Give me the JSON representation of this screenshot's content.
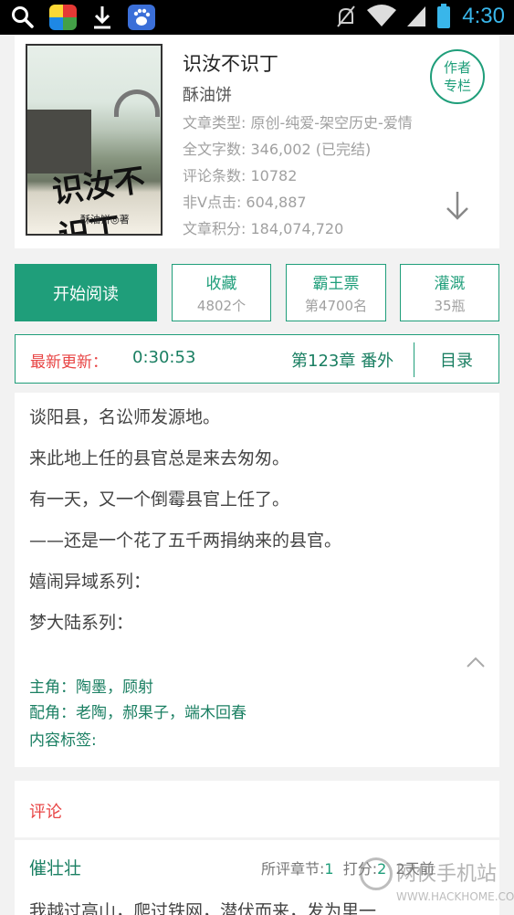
{
  "status_bar": {
    "time": "4:30",
    "icons": [
      "search-icon",
      "game-center-icon",
      "download-icon",
      "baidu-icon",
      "mute-icon",
      "wifi-icon",
      "signal-icon",
      "battery-icon"
    ]
  },
  "book": {
    "title": "识汝不识丁",
    "author": "酥油饼",
    "cover_title": "识汝不识丁",
    "cover_author": "酥油饼◎著",
    "meta": [
      "文章类型: 原创-纯爱-架空历史-爱情",
      "全文字数: 346,002 (已完结)",
      "评论条数: 10782",
      "非V点击: 604,887",
      "文章积分: 184,074,720"
    ],
    "author_column_label_1": "作者",
    "author_column_label_2": "专栏"
  },
  "actions": {
    "read": "开始阅读",
    "favorite": {
      "label": "收藏",
      "value": "4802个"
    },
    "overlord": {
      "label": "霸王票",
      "value": "第4700名"
    },
    "nutrient": {
      "label": "灌溉",
      "value": "35瓶"
    }
  },
  "latest_update": {
    "label": "最新更新：",
    "time": "0:30:53",
    "chapter": "第123章  番外",
    "toc": "目录"
  },
  "synopsis": {
    "lines": [
      "谈阳县，名讼师发源地。",
      "来此地上任的县官总是来去匆匆。",
      "有一天，又一个倒霉县官上任了。",
      "——还是一个花了五千两捐纳来的县官。",
      "嬉闹异域系列：",
      "梦大陆系列："
    ],
    "protagonists": "主角：陶墨，顾射",
    "supporting": "配角：老陶，郝果子，端木回春",
    "tags": "内容标签:"
  },
  "comments": {
    "header": "评论",
    "first": {
      "user": "催壮壮",
      "chapter_label": "所评章节:",
      "chapter_value": "1",
      "score_label": "打分:",
      "score_value": "2",
      "time": "2天前",
      "body": "我越过高山，爬过铁网，潜伏而来，发为里一"
    }
  },
  "watermark": {
    "text": "网侠手机站",
    "sub": "WWW.HACKHOME.COM"
  },
  "colors": {
    "accent": "#1f9e7a",
    "accent_text": "#1a7f62",
    "highlight": "#e84545",
    "muted": "#a0a0a0"
  }
}
